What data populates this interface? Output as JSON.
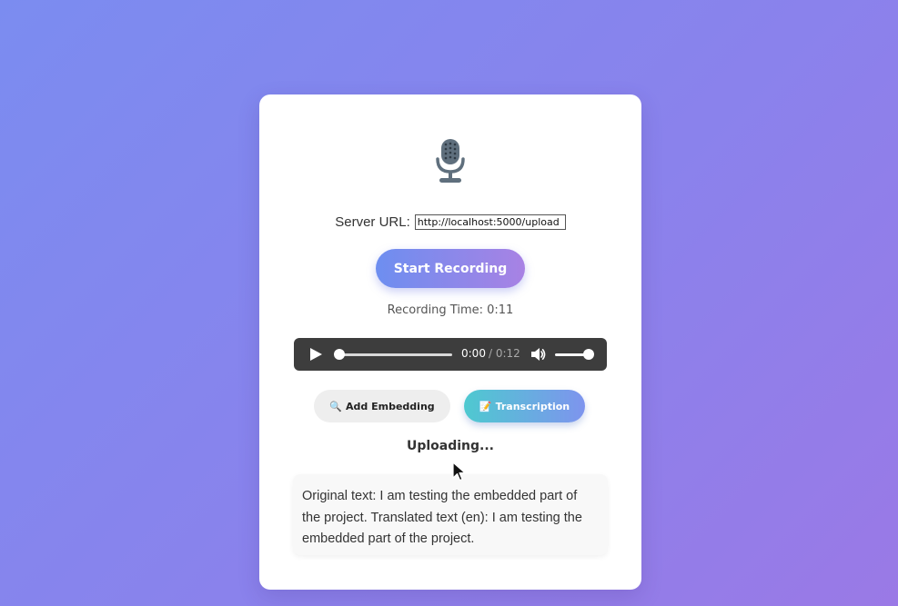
{
  "icons": {
    "mic": "microphone-icon",
    "play": "play-icon",
    "volume": "volume-icon",
    "embed": "magnifier-icon",
    "transcription": "memo-icon",
    "cursor": "mouse-cursor-icon"
  },
  "colors": {
    "background_start": "#7b8cf0",
    "background_end": "#9a79e6",
    "record_gradient_start": "#6d8ef0",
    "record_gradient_end": "#a882e4",
    "transcription_gradient_start": "#4ec9d0",
    "transcription_gradient_end": "#7e94ee",
    "player_bg": "#3d3d3d"
  },
  "server": {
    "label": "Server URL:",
    "url_value": "http://localhost:5000/upload"
  },
  "record": {
    "button_label": "Start Recording",
    "time_text": "Recording Time: 0:11"
  },
  "player": {
    "current_time": "0:00",
    "duration_text": "/ 0:12",
    "progress": 0,
    "volume": 1
  },
  "actions": {
    "embed_icon": "🔍",
    "embed_label": "Add Embedding",
    "transcription_icon": "📝",
    "transcription_label": "Transcription"
  },
  "status": {
    "text": "Uploading..."
  },
  "result": {
    "text": "Original text: I am testing the embedded part of the project. Translated text (en): I am testing the embedded part of the project."
  }
}
